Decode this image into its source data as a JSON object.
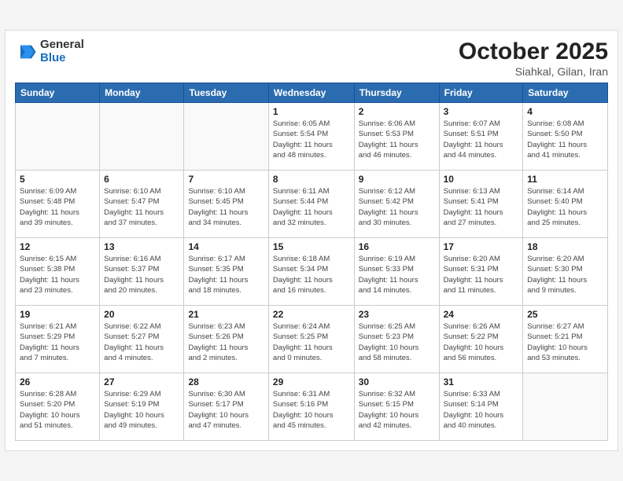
{
  "header": {
    "logo_general": "General",
    "logo_blue": "Blue",
    "month_title": "October 2025",
    "location": "Siahkal, Gilan, Iran"
  },
  "weekdays": [
    "Sunday",
    "Monday",
    "Tuesday",
    "Wednesday",
    "Thursday",
    "Friday",
    "Saturday"
  ],
  "weeks": [
    [
      {
        "day": "",
        "info": ""
      },
      {
        "day": "",
        "info": ""
      },
      {
        "day": "",
        "info": ""
      },
      {
        "day": "1",
        "info": "Sunrise: 6:05 AM\nSunset: 5:54 PM\nDaylight: 11 hours\nand 48 minutes."
      },
      {
        "day": "2",
        "info": "Sunrise: 6:06 AM\nSunset: 5:53 PM\nDaylight: 11 hours\nand 46 minutes."
      },
      {
        "day": "3",
        "info": "Sunrise: 6:07 AM\nSunset: 5:51 PM\nDaylight: 11 hours\nand 44 minutes."
      },
      {
        "day": "4",
        "info": "Sunrise: 6:08 AM\nSunset: 5:50 PM\nDaylight: 11 hours\nand 41 minutes."
      }
    ],
    [
      {
        "day": "5",
        "info": "Sunrise: 6:09 AM\nSunset: 5:48 PM\nDaylight: 11 hours\nand 39 minutes."
      },
      {
        "day": "6",
        "info": "Sunrise: 6:10 AM\nSunset: 5:47 PM\nDaylight: 11 hours\nand 37 minutes."
      },
      {
        "day": "7",
        "info": "Sunrise: 6:10 AM\nSunset: 5:45 PM\nDaylight: 11 hours\nand 34 minutes."
      },
      {
        "day": "8",
        "info": "Sunrise: 6:11 AM\nSunset: 5:44 PM\nDaylight: 11 hours\nand 32 minutes."
      },
      {
        "day": "9",
        "info": "Sunrise: 6:12 AM\nSunset: 5:42 PM\nDaylight: 11 hours\nand 30 minutes."
      },
      {
        "day": "10",
        "info": "Sunrise: 6:13 AM\nSunset: 5:41 PM\nDaylight: 11 hours\nand 27 minutes."
      },
      {
        "day": "11",
        "info": "Sunrise: 6:14 AM\nSunset: 5:40 PM\nDaylight: 11 hours\nand 25 minutes."
      }
    ],
    [
      {
        "day": "12",
        "info": "Sunrise: 6:15 AM\nSunset: 5:38 PM\nDaylight: 11 hours\nand 23 minutes."
      },
      {
        "day": "13",
        "info": "Sunrise: 6:16 AM\nSunset: 5:37 PM\nDaylight: 11 hours\nand 20 minutes."
      },
      {
        "day": "14",
        "info": "Sunrise: 6:17 AM\nSunset: 5:35 PM\nDaylight: 11 hours\nand 18 minutes."
      },
      {
        "day": "15",
        "info": "Sunrise: 6:18 AM\nSunset: 5:34 PM\nDaylight: 11 hours\nand 16 minutes."
      },
      {
        "day": "16",
        "info": "Sunrise: 6:19 AM\nSunset: 5:33 PM\nDaylight: 11 hours\nand 14 minutes."
      },
      {
        "day": "17",
        "info": "Sunrise: 6:20 AM\nSunset: 5:31 PM\nDaylight: 11 hours\nand 11 minutes."
      },
      {
        "day": "18",
        "info": "Sunrise: 6:20 AM\nSunset: 5:30 PM\nDaylight: 11 hours\nand 9 minutes."
      }
    ],
    [
      {
        "day": "19",
        "info": "Sunrise: 6:21 AM\nSunset: 5:29 PM\nDaylight: 11 hours\nand 7 minutes."
      },
      {
        "day": "20",
        "info": "Sunrise: 6:22 AM\nSunset: 5:27 PM\nDaylight: 11 hours\nand 4 minutes."
      },
      {
        "day": "21",
        "info": "Sunrise: 6:23 AM\nSunset: 5:26 PM\nDaylight: 11 hours\nand 2 minutes."
      },
      {
        "day": "22",
        "info": "Sunrise: 6:24 AM\nSunset: 5:25 PM\nDaylight: 11 hours\nand 0 minutes."
      },
      {
        "day": "23",
        "info": "Sunrise: 6:25 AM\nSunset: 5:23 PM\nDaylight: 10 hours\nand 58 minutes."
      },
      {
        "day": "24",
        "info": "Sunrise: 6:26 AM\nSunset: 5:22 PM\nDaylight: 10 hours\nand 56 minutes."
      },
      {
        "day": "25",
        "info": "Sunrise: 6:27 AM\nSunset: 5:21 PM\nDaylight: 10 hours\nand 53 minutes."
      }
    ],
    [
      {
        "day": "26",
        "info": "Sunrise: 6:28 AM\nSunset: 5:20 PM\nDaylight: 10 hours\nand 51 minutes."
      },
      {
        "day": "27",
        "info": "Sunrise: 6:29 AM\nSunset: 5:19 PM\nDaylight: 10 hours\nand 49 minutes."
      },
      {
        "day": "28",
        "info": "Sunrise: 6:30 AM\nSunset: 5:17 PM\nDaylight: 10 hours\nand 47 minutes."
      },
      {
        "day": "29",
        "info": "Sunrise: 6:31 AM\nSunset: 5:16 PM\nDaylight: 10 hours\nand 45 minutes."
      },
      {
        "day": "30",
        "info": "Sunrise: 6:32 AM\nSunset: 5:15 PM\nDaylight: 10 hours\nand 42 minutes."
      },
      {
        "day": "31",
        "info": "Sunrise: 6:33 AM\nSunset: 5:14 PM\nDaylight: 10 hours\nand 40 minutes."
      },
      {
        "day": "",
        "info": ""
      }
    ]
  ]
}
